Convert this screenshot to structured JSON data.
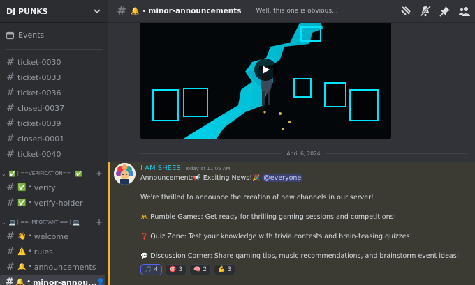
{
  "server": {
    "name": "DJ PUNKS"
  },
  "sidebar": {
    "events_label": "Events",
    "channels_top": [
      {
        "label": "ticket-0030"
      },
      {
        "label": "ticket-0033"
      },
      {
        "label": "ticket-0036"
      },
      {
        "label": "closed-0037"
      },
      {
        "label": "ticket-0039"
      },
      {
        "label": "closed-0001"
      },
      {
        "label": "ticket-0040"
      }
    ],
    "category_verification": {
      "label": "| ==VERIFICATION== |",
      "emoji": "✅"
    },
    "verification_channels": [
      {
        "emoji": "✅",
        "label": "verify"
      },
      {
        "emoji": "✅",
        "label": "verify-holder"
      }
    ],
    "category_important": {
      "label": "| == IMPORTANT == |",
      "emoji": "💻"
    },
    "important_channels": [
      {
        "emoji": "👋",
        "label": "welcome"
      },
      {
        "emoji": "⚠️",
        "label": "rules"
      },
      {
        "emoji": "🔔",
        "label": "announcements"
      },
      {
        "emoji": "🔔",
        "label": "minor-annou..."
      }
    ]
  },
  "topbar": {
    "channel_emoji": "🔔",
    "channel_name": "minor-announcements",
    "topic": "Well, this one is obvious..."
  },
  "divider_date": "April 6, 2024",
  "message": {
    "author": "I AM SHEES",
    "timestamp": "Today at 11:05 AM",
    "line1_prefix": "Announcement:",
    "line1_mid": "Exciting News!",
    "mention": "@everyone",
    "line2": "We're thrilled to announce the creation of new channels in our server!",
    "line3": "Rumble Games: Get ready for thrilling gaming sessions and competitions!",
    "line4": "Quiz Zone: Test your knowledge with trivia contests and brain-teasing quizzes!",
    "line5": "Discussion Corner: Share gaming tips, music recommendations, and brainstorm event ideas!",
    "reactions": [
      {
        "emoji": "🎵",
        "count": "4",
        "mine": true
      },
      {
        "emoji": "🎯",
        "count": "3",
        "mine": false
      },
      {
        "emoji": "🧠",
        "count": "2",
        "mine": false
      },
      {
        "emoji": "💪",
        "count": "3",
        "mine": false
      }
    ]
  },
  "colors": {
    "accent": "#5865f2",
    "author": "#26c8e0",
    "highlight_bar": "#f0b232",
    "neon": "#00e5ff"
  }
}
